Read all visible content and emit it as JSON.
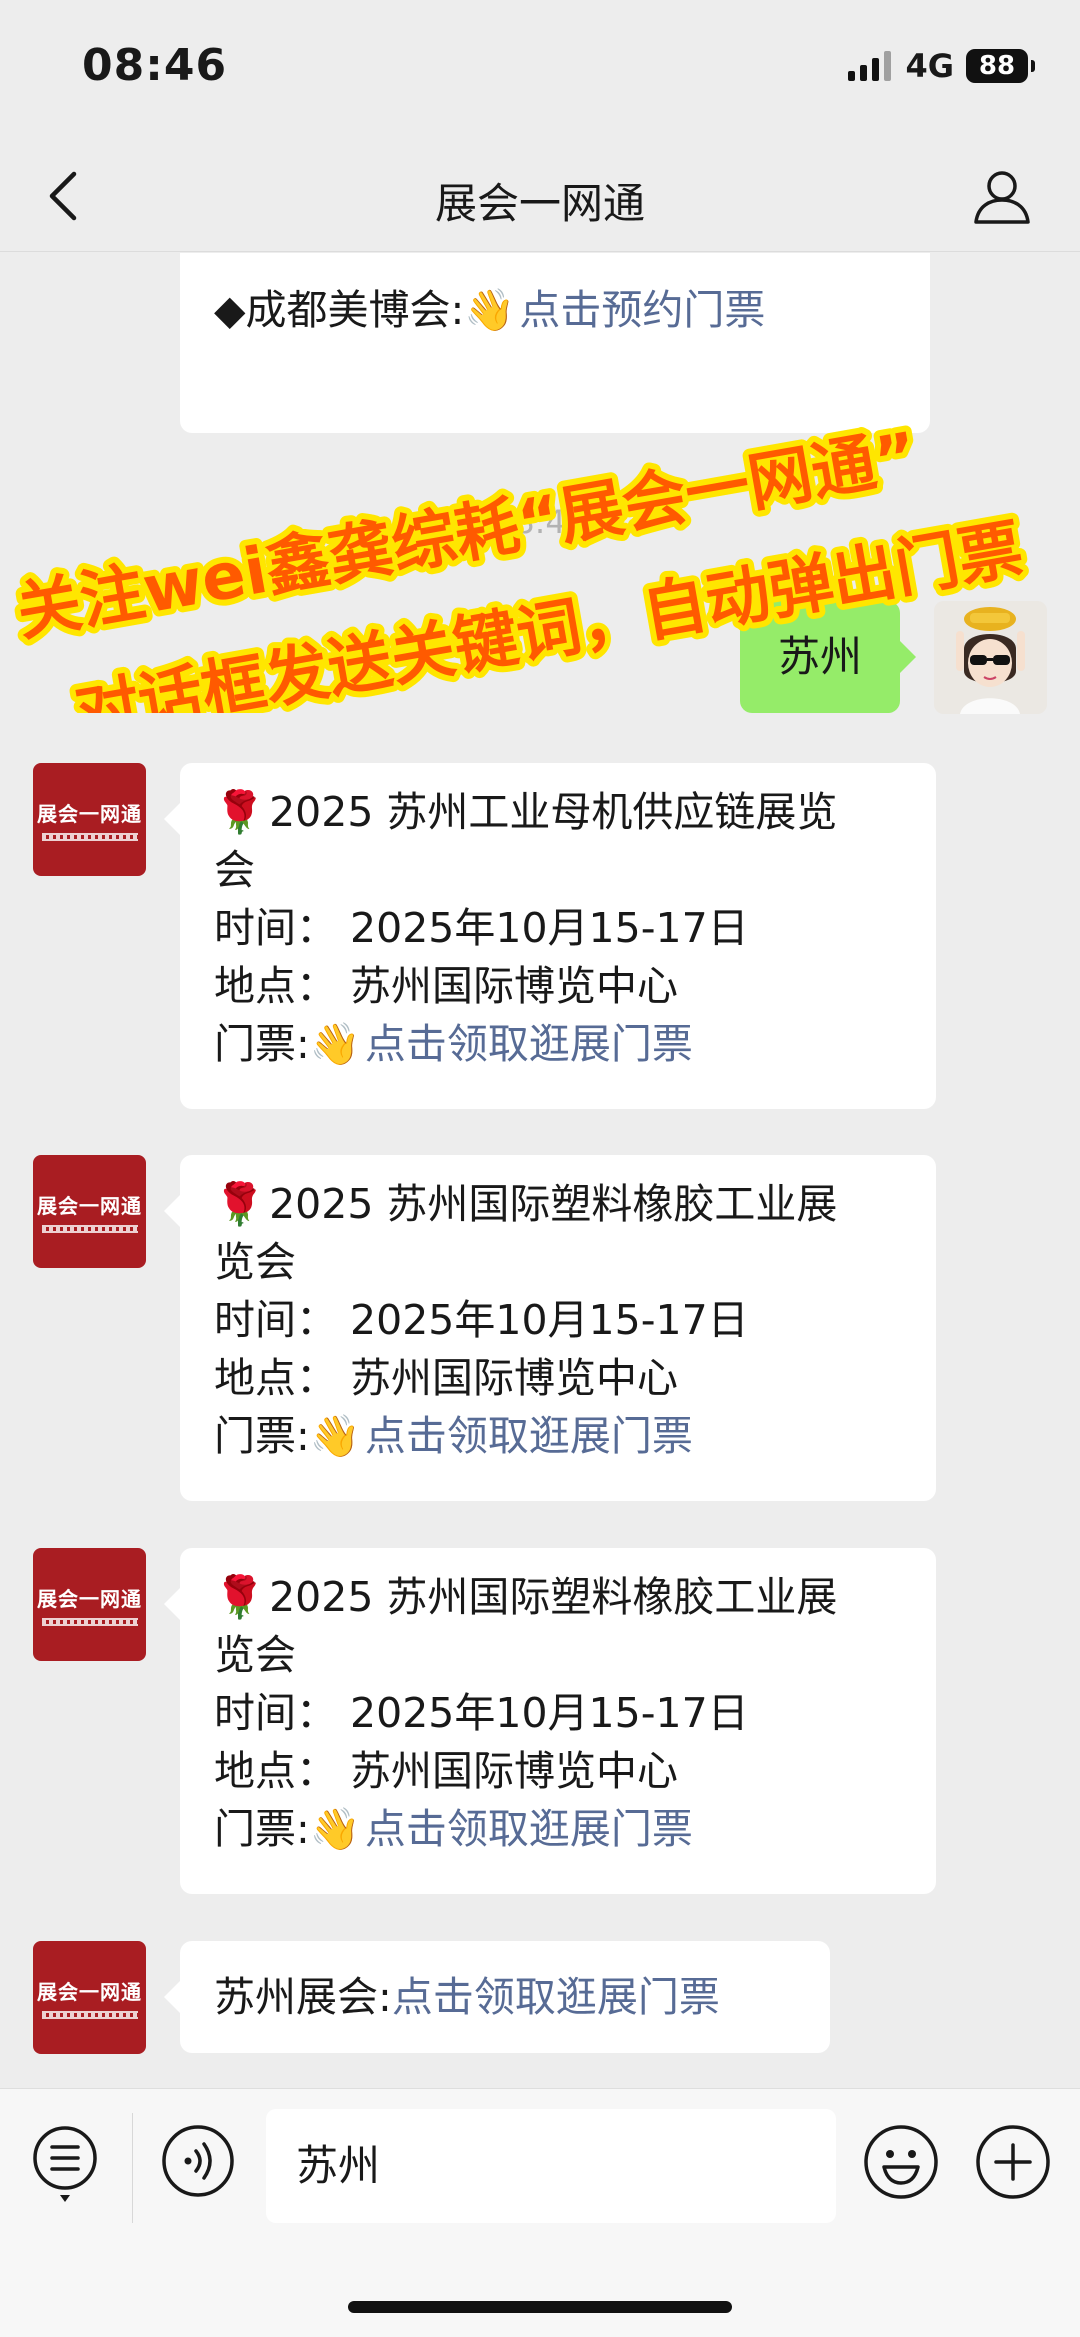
{
  "status_bar": {
    "time": "08:46",
    "network": "4G",
    "battery": "88"
  },
  "nav": {
    "title": "展会一网通"
  },
  "chat": {
    "first_message": {
      "prefix": "◆成都美博会:",
      "emoji": "👋",
      "link": "点击预约门票"
    },
    "timestamp": "08:46",
    "user_message": "苏州",
    "org_avatar_text": "展会一网通",
    "messages": [
      {
        "title_emoji": "🌹",
        "title_line1": "2025 苏州工业母机供应链展览",
        "title_line2": "会",
        "time": "时间： 2025年10月15-17日",
        "place": "地点： 苏州国际博览中心",
        "ticket_label": "门票:",
        "ticket_emoji": "👋",
        "ticket_link": "点击领取逛展门票"
      },
      {
        "title_emoji": "🌹",
        "title_line1": "2025 苏州国际塑料橡胶工业展",
        "title_line2": "览会",
        "time": "时间： 2025年10月15-17日",
        "place": "地点： 苏州国际博览中心",
        "ticket_label": "门票:",
        "ticket_emoji": "👋",
        "ticket_link": "点击领取逛展门票"
      },
      {
        "title_emoji": "🌹",
        "title_line1": "2025 苏州国际塑料橡胶工业展",
        "title_line2": "览会",
        "time": "时间： 2025年10月15-17日",
        "place": "地点： 苏州国际博览中心",
        "ticket_label": "门票:",
        "ticket_emoji": "👋",
        "ticket_link": "点击领取逛展门票"
      }
    ],
    "last_message": {
      "prefix": "苏州展会:",
      "link": "点击领取逛展门票"
    }
  },
  "banner": {
    "line1": "关注wei鑫龚综耗“展会一网通”",
    "line2": "对话框发送关键词，自动弹出门票"
  },
  "input_bar": {
    "value": "苏州"
  },
  "colors": {
    "link": "#576b95",
    "user_bubble": "#95ec69",
    "org_avatar": "#a91d22",
    "banner_fill": "#ff5a00",
    "banner_stroke": "#ffe600"
  }
}
